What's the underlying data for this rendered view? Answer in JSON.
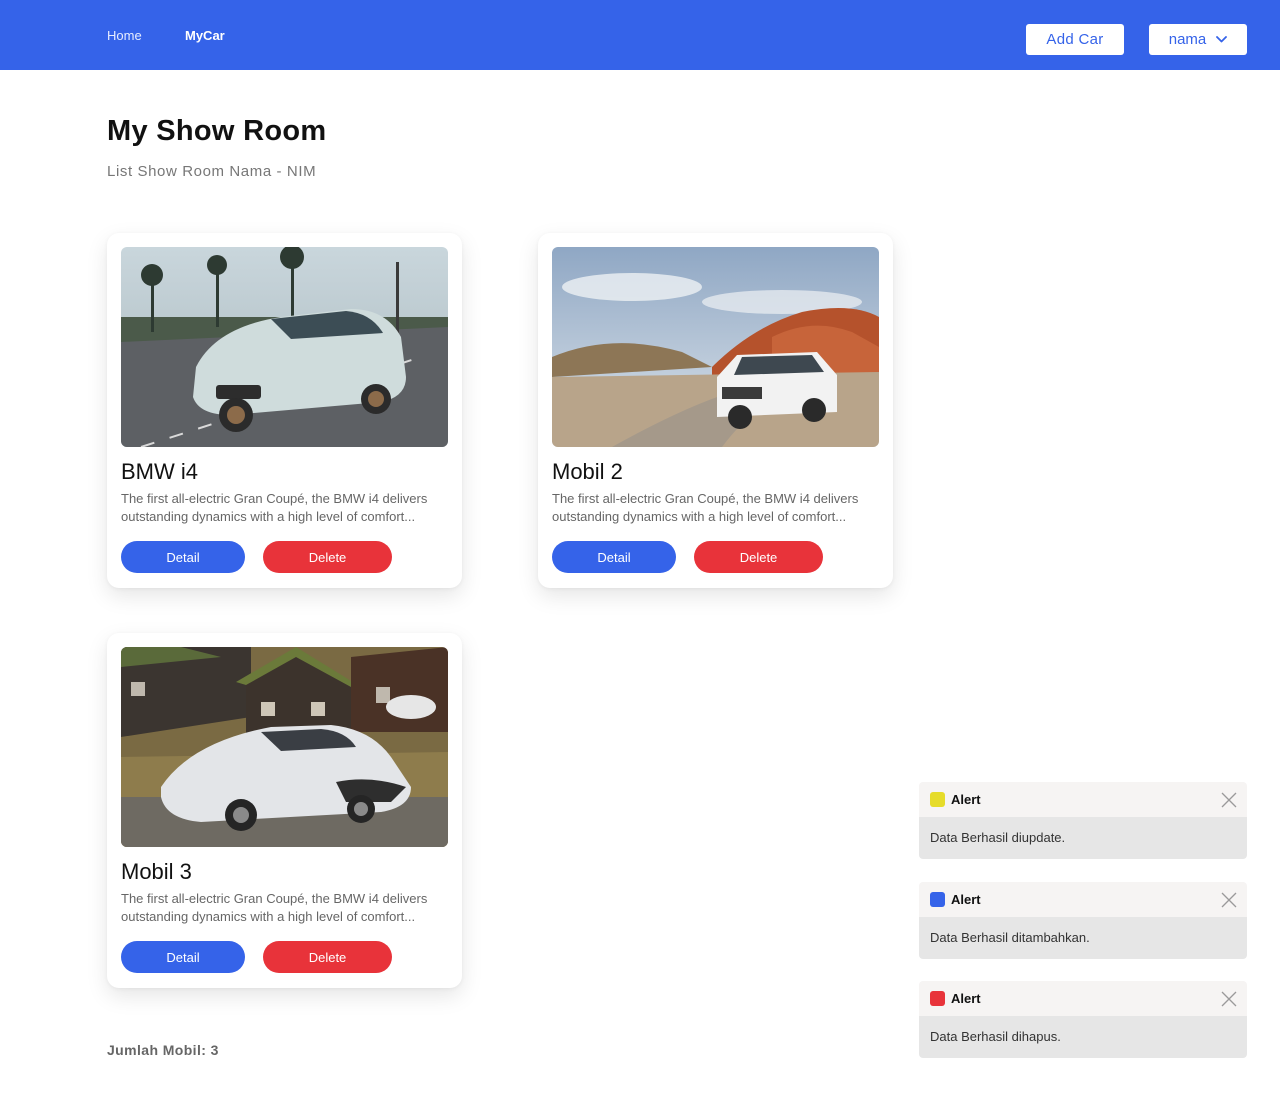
{
  "nav": {
    "home": "Home",
    "mycar": "MyCar",
    "add_car": "Add Car",
    "user": "nama"
  },
  "header": {
    "title": "My Show Room",
    "subtitle": "List Show Room Nama - NIM"
  },
  "cars": [
    {
      "title": "BMW i4",
      "description": "The first all-electric Gran Coupé, the BMW i4 delivers outstanding dynamics with a high level of comfort...",
      "detail_label": "Detail",
      "delete_label": "Delete"
    },
    {
      "title": "Mobil 2",
      "description": "The first all-electric Gran Coupé, the BMW i4 delivers outstanding dynamics with a high level of comfort...",
      "detail_label": "Detail",
      "delete_label": "Delete"
    },
    {
      "title": "Mobil 3",
      "description": "The first all-electric Gran Coupé, the BMW i4 delivers outstanding dynamics with a high level of comfort...",
      "detail_label": "Detail",
      "delete_label": "Delete"
    }
  ],
  "footer": {
    "count": "Jumlah Mobil: 3"
  },
  "alerts": [
    {
      "title": "Alert",
      "message": "Data Berhasil diupdate.",
      "color": "#e6dc2a"
    },
    {
      "title": "Alert",
      "message": "Data Berhasil ditambahkan.",
      "color": "#3563e9"
    },
    {
      "title": "Alert",
      "message": "Data Berhasil dihapus.",
      "color": "#e8333a"
    }
  ],
  "colors": {
    "primary": "#3563e9",
    "danger": "#e8333a"
  }
}
